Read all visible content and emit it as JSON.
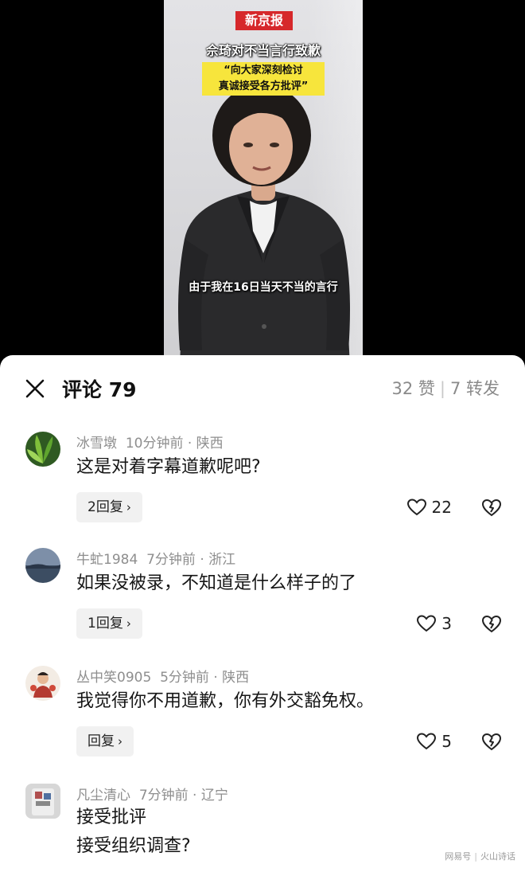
{
  "video": {
    "logo": "新京报",
    "title": "佘琦对不当言行致歉",
    "quote_line1": "“向大家深刻检讨",
    "quote_line2": "真诚接受各方批评”",
    "caption": "由于我在16日当天不当的言行"
  },
  "comments_panel": {
    "title": "评论 79",
    "likes": "32 赞",
    "separator": "|",
    "shares": "7 转发",
    "close_icon": "close-icon"
  },
  "comments": [
    {
      "author": "冰雪墩",
      "time": "10分钟前",
      "location": "陕西",
      "lines": [
        "这是对着字幕道歉呢吧?"
      ],
      "reply_label": "2回复",
      "like_count": "22",
      "avatar_color": "#3f6b2a"
    },
    {
      "author": "牛虻1984",
      "time": "7分钟前",
      "location": "浙江",
      "lines": [
        "如果没被录，不知道是什么样子的了"
      ],
      "reply_label": "1回复",
      "like_count": "3",
      "avatar_color": "#5c6f86"
    },
    {
      "author": "丛中笑0905",
      "time": "5分钟前",
      "location": "陕西",
      "lines": [
        "我觉得你不用道歉，你有外交豁免权。"
      ],
      "reply_label": "回复",
      "like_count": "5",
      "avatar_color": "#b43a30"
    },
    {
      "author": "凡尘清心",
      "time": "7分钟前",
      "location": "辽宁",
      "lines": [
        "接受批评",
        "接受组织调查?"
      ],
      "avatar_color": "#6c6c6c"
    }
  ],
  "meta_separator": "·",
  "watermark": {
    "left": "网易号",
    "right": "火山诗话"
  }
}
